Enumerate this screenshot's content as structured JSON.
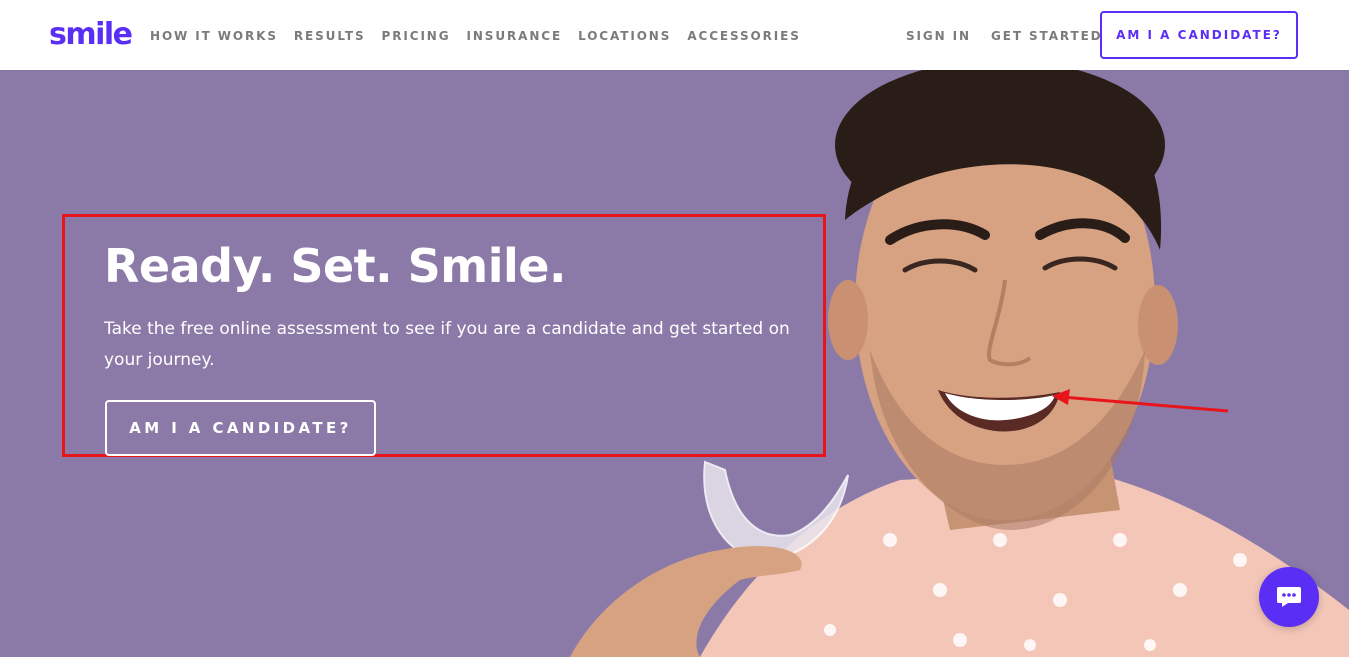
{
  "brand": {
    "logo_text": "smile",
    "accent": "#5b2ef5",
    "hero_bg": "#8b7aa8",
    "annotation_color": "#e8141c"
  },
  "nav": {
    "items": [
      {
        "label": "HOW IT WORKS"
      },
      {
        "label": "RESULTS"
      },
      {
        "label": "PRICING"
      },
      {
        "label": "INSURANCE"
      },
      {
        "label": "LOCATIONS"
      },
      {
        "label": "ACCESSORIES"
      }
    ],
    "right": [
      {
        "label": "SIGN IN"
      },
      {
        "label": "GET STARTED"
      }
    ],
    "cta_label": "AM I A CANDIDATE?"
  },
  "hero": {
    "title": "Ready. Set. Smile.",
    "subtitle": "Take the free online assessment to see if you are a candidate and get started on your journey.",
    "cta_label": "AM I A CANDIDATE?"
  },
  "icons": {
    "chat": "chat-bubble-icon"
  }
}
